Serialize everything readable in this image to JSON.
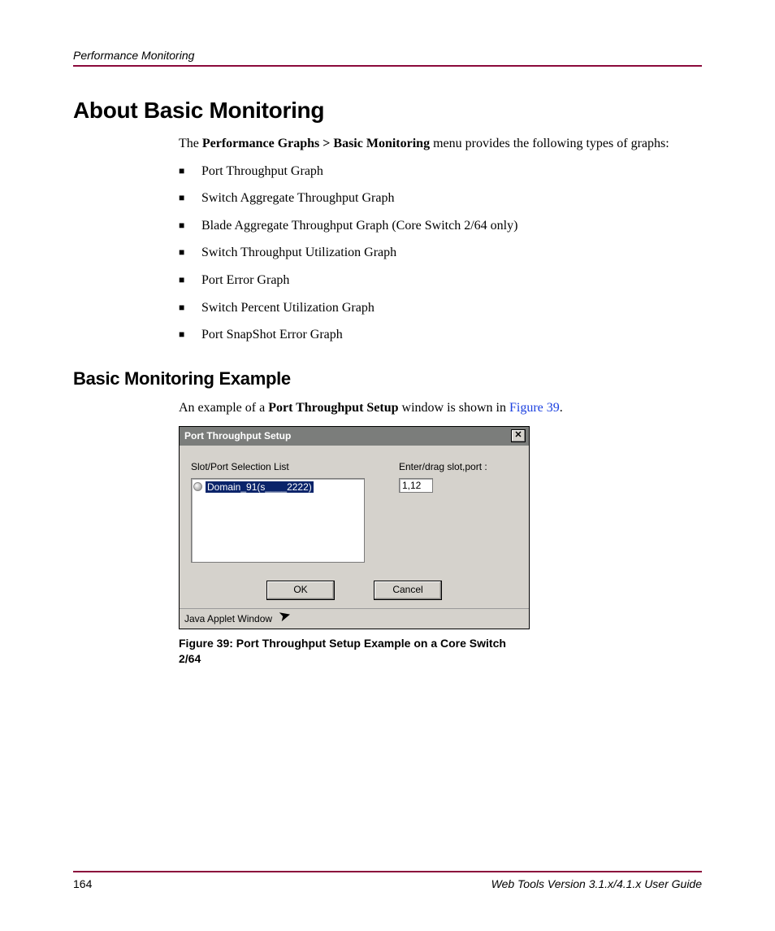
{
  "header": {
    "running_head": "Performance Monitoring"
  },
  "section": {
    "title": "About Basic Monitoring",
    "intro_pre": "The ",
    "intro_bold": "Performance Graphs > Basic Monitoring",
    "intro_post": " menu provides the following types of graphs:",
    "bullets": [
      "Port Throughput Graph",
      "Switch Aggregate Throughput Graph",
      "Blade Aggregate Throughput Graph (Core Switch 2/64 only)",
      "Switch Throughput Utilization Graph",
      "Port Error Graph",
      "Switch Percent Utilization Graph",
      "Port SnapShot Error Graph"
    ]
  },
  "subsection": {
    "title": "Basic Monitoring Example",
    "para_pre": "An example of a ",
    "para_bold": "Port Throughput Setup",
    "para_mid": " window is shown in ",
    "para_link": "Figure 39",
    "para_post": "."
  },
  "dialog": {
    "title": "Port Throughput Setup",
    "close_glyph": "✕",
    "left_label": "Slot/Port Selection List",
    "right_label": "Enter/drag slot,port :",
    "tree_item": "Domain_91(s____2222)",
    "textbox_value": "1,12",
    "ok": "OK",
    "cancel": "Cancel",
    "statusbar": "Java Applet Window"
  },
  "figure": {
    "caption": "Figure 39:  Port Throughput Setup Example on a Core Switch 2/64"
  },
  "footer": {
    "page": "164",
    "doc": "Web Tools Version 3.1.x/4.1.x User Guide"
  }
}
